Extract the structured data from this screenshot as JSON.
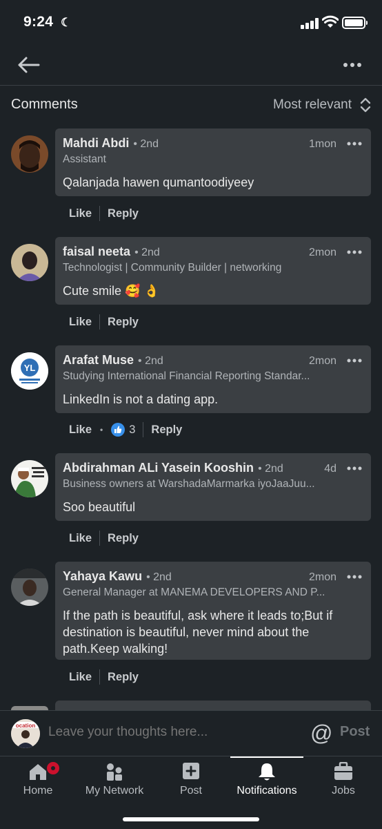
{
  "status_bar": {
    "time": "9:24"
  },
  "comments_header": {
    "title": "Comments",
    "sort_label": "Most relevant"
  },
  "comments": [
    {
      "name": "Mahdi Abdi",
      "degree": "• 2nd",
      "time": "1mon",
      "headline": "Assistant",
      "text": "Qalanjada hawen qumantoodiyeey",
      "like": "Like",
      "reply": "Reply"
    },
    {
      "name": "faisal neeta",
      "degree": "• 2nd",
      "time": "2mon",
      "headline": "Technologist | Community Builder | networking",
      "text": "Cute smile 🥰 👌",
      "like": "Like",
      "reply": "Reply"
    },
    {
      "name": "Arafat Muse",
      "degree": "• 2nd",
      "time": "2mon",
      "headline": "Studying International Financial Reporting Standar...",
      "text": "LinkedIn  is not a dating app.",
      "like": "Like",
      "reaction_count": "3",
      "reply": "Reply"
    },
    {
      "name": "Abdirahman ALi Yasein Kooshin",
      "degree": "• 2nd",
      "time": "4d",
      "headline": "Business owners at WarshadaMarmarka iyoJaaJuu...",
      "text": "Soo beautiful",
      "like": "Like",
      "reply": "Reply"
    },
    {
      "name": "Yahaya Kawu",
      "degree": "• 2nd",
      "time": "2mon",
      "headline": "General Manager at MANEMA DEVELOPERS AND P...",
      "text": "If the path is beautiful, ask where it leads to;But if destination is beautiful, never mind about the path.Keep walking!",
      "like": "Like",
      "reply": "Reply"
    }
  ],
  "input_bar": {
    "placeholder": "Leave your thoughts here...",
    "at_symbol": "@",
    "post_label": "Post"
  },
  "tabs": [
    {
      "label": "Home",
      "icon": "home-icon"
    },
    {
      "label": "My Network",
      "icon": "network-icon"
    },
    {
      "label": "Post",
      "icon": "post-icon"
    },
    {
      "label": "Notifications",
      "icon": "bell-icon",
      "active": true
    },
    {
      "label": "Jobs",
      "icon": "briefcase-icon"
    }
  ],
  "colors": {
    "background": "#1d2226",
    "bubble": "#3b3f43",
    "badge": "#cb112d",
    "reaction_blue": "#378fe9"
  }
}
